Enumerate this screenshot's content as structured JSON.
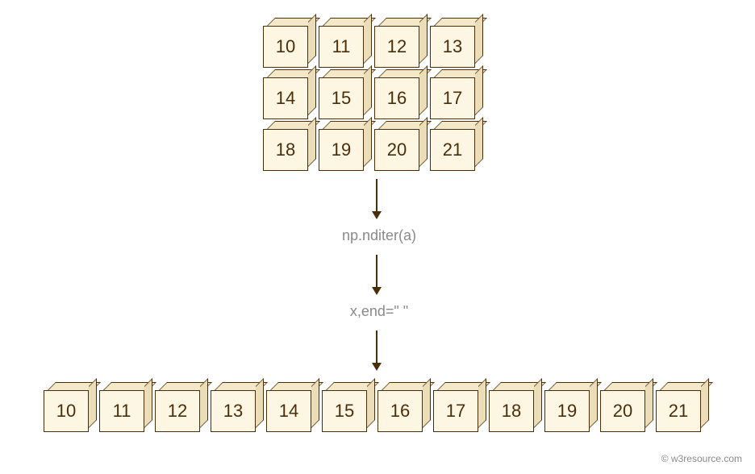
{
  "grid": {
    "rows": 3,
    "cols": 4,
    "values": [
      [
        10,
        11,
        12,
        13
      ],
      [
        14,
        15,
        16,
        17
      ],
      [
        18,
        19,
        20,
        21
      ]
    ]
  },
  "step1_label": "np.nditer(a)",
  "step2_label": "x,end=\" \"",
  "flat": [
    10,
    11,
    12,
    13,
    14,
    15,
    16,
    17,
    18,
    19,
    20,
    21
  ],
  "attribution": "© w3resource.com",
  "colors": {
    "cube_front": "#fdf6e3",
    "cube_border": "#4a2e0a",
    "text_label": "#8a8a8a"
  }
}
